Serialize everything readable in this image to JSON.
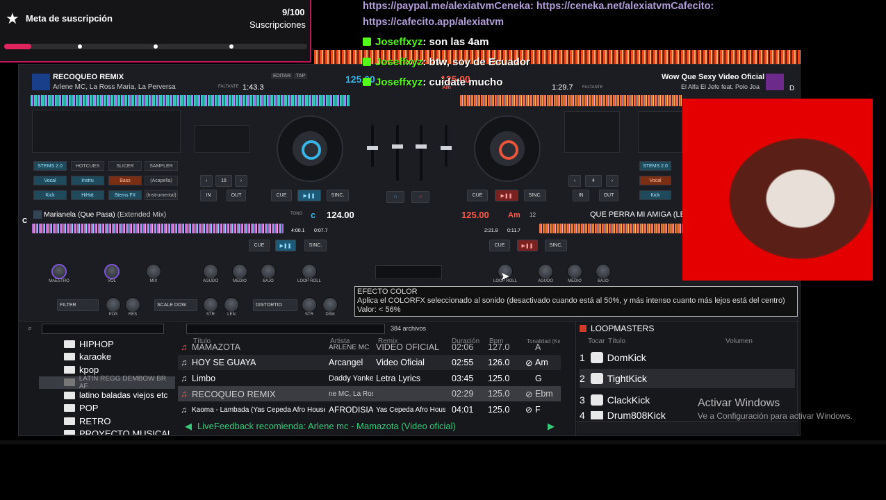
{
  "overlay": {
    "goal_label": "Meta de suscripción",
    "count": "9/100",
    "unit": "Suscripciones",
    "progress": 0.09
  },
  "chat": {
    "link_line1": "https://paypal.me/alexiatvmCeneka: https://ceneka.net/alexiatvmCafecito:",
    "link_line2": "https://cafecito.app/alexiatvm",
    "messages": [
      {
        "user": "Joseffxyz",
        "text": ": son las 4am"
      },
      {
        "user": "Joseffxyz",
        "text": ": btw, soy de Ecuador"
      },
      {
        "user": "Joseffxyz",
        "text": ": cuidate mucho"
      }
    ]
  },
  "deck_a": {
    "title": "RECOQUEO REMIX",
    "artist": "Arlene MC, La Ross Maria, La Perversa",
    "bpm": "125.00",
    "remaining_label": "FALTANTE",
    "remaining": "1:43.3",
    "buttons": [
      "EDITAR",
      "TAP"
    ],
    "stems_tabs": [
      "STEMS 2.0",
      "HOTCUES",
      "SLICER",
      "SAMPLER"
    ],
    "stems": [
      "Vocal",
      "Instru",
      "Bass",
      "(Acapella)",
      "Kick",
      "HiHat",
      "Stems FX",
      "(Instrumental)"
    ],
    "loop": "16",
    "in": "IN",
    "out": "OUT",
    "cue": "CUE",
    "sync": "SINC."
  },
  "deck_b": {
    "title": "Wow Que Sexy Video Oficial",
    "artist": "El Alfa El Jefe feat. Polo Joa",
    "bpm": "125.00",
    "key": "Am",
    "remaining": "1:29.7",
    "remaining_label": "FALTANTE",
    "letter": "D",
    "loop": "4",
    "stems_tab": "STEMS 2.0",
    "stems": [
      "Vocal",
      "Kick"
    ],
    "in": "IN",
    "out": "OUT",
    "cue": "CUE",
    "sync": "SINC."
  },
  "deck_c": {
    "title": "Marianela (Que Pasa)",
    "mix": "(Extended Mix)",
    "letter": "C",
    "key": "c",
    "bpm": "124.00",
    "tono": "TONO",
    "tiempo": "4:00.1",
    "faltante": "0:07.7",
    "cue": "CUE",
    "sync": "SINC."
  },
  "deck_d": {
    "title": "QUE PERRA MI AMIGA (LET",
    "bpm": "125.00",
    "key": "Am",
    "num": "12",
    "tiempo": "2:21.8",
    "faltante": "0:11.7",
    "cue": "CUE",
    "sync": "SINC."
  },
  "mixer": {
    "labels": [
      "MAESTRO",
      "VOL",
      "MIX",
      "AGUDO",
      "MEDIO",
      "BAJO",
      "LOOP ROLL",
      "LOOP ROLL",
      "AGUDO",
      "MEDIO",
      "BAJO"
    ],
    "fx": [
      "FILTER",
      "SCALE DOW",
      "DISTORTIO"
    ],
    "fx_knobs": [
      "POS",
      "RES",
      "STR",
      "LEN",
      "STR",
      "DSM"
    ]
  },
  "tooltip": {
    "title": "EFECTO COLOR",
    "body": "Aplica el COLORFX seleccionado al sonido (desactivado cuando está al 50%, y más intenso cuanto más lejos está del centro)",
    "value": "Valor: < 56%"
  },
  "browser": {
    "file_count": "384 archivos",
    "folders": [
      "HIPHOP",
      "karaoke",
      "kpop",
      "LATIN REGG DEMBOW BR AF",
      "latino baladas viejos etc",
      "POP",
      "RETRO",
      "PROYECTO MUSICAL"
    ],
    "columns": [
      "Título",
      "Artista",
      "Remix",
      "Duración",
      "Bpm",
      "Tonalidad (Key"
    ],
    "tracks": [
      {
        "title": "MAMAZOTA",
        "artist": "ARLENE MC",
        "remix": "VIDEO OFICIAL",
        "dur": "02:06",
        "bpm": "127.0",
        "key": "A"
      },
      {
        "title": "HOY SE GUAYA",
        "artist": "Arcangel",
        "remix": "Video Oficial",
        "dur": "02:55",
        "bpm": "126.0",
        "key": "Am"
      },
      {
        "title": "Limbo",
        "artist": "Daddy Yankee",
        "remix": "Letra  Lyrics",
        "dur": "03:45",
        "bpm": "125.0",
        "key": "G"
      },
      {
        "title": "RECOQUEO REMIX",
        "artist": "ne MC, La Ross",
        "remix": "",
        "dur": "02:29",
        "bpm": "125.0",
        "key": "Ebm"
      },
      {
        "title": "Kaoma - Lambada (Yas Cepeda Afro House R...",
        "artist": "AFRODISIA",
        "remix": "Yas Cepeda Afro Hous...",
        "dur": "04:01",
        "bpm": "125.0",
        "key": "F"
      }
    ],
    "live_feedback": "LiveFeedback recomienda: Arlene mc - Mamazota (Video oficial)"
  },
  "loopmasters": {
    "title": "LOOPMASTERS",
    "columns": [
      "Tocar",
      "Título",
      "Volumen"
    ],
    "items": [
      {
        "n": "1",
        "name": "DomKick"
      },
      {
        "n": "2",
        "name": "TightKick"
      },
      {
        "n": "3",
        "name": "ClackKick"
      },
      {
        "n": "4",
        "name": "Drum808Kick"
      }
    ]
  },
  "windows": {
    "line1": "Activar Windows",
    "line2": "Ve a Configuración para activar Windows."
  },
  "colors": {
    "blue": "#39b4e6",
    "red": "#e8553a",
    "accent": "#c2185b",
    "kick": "#53fc18"
  }
}
